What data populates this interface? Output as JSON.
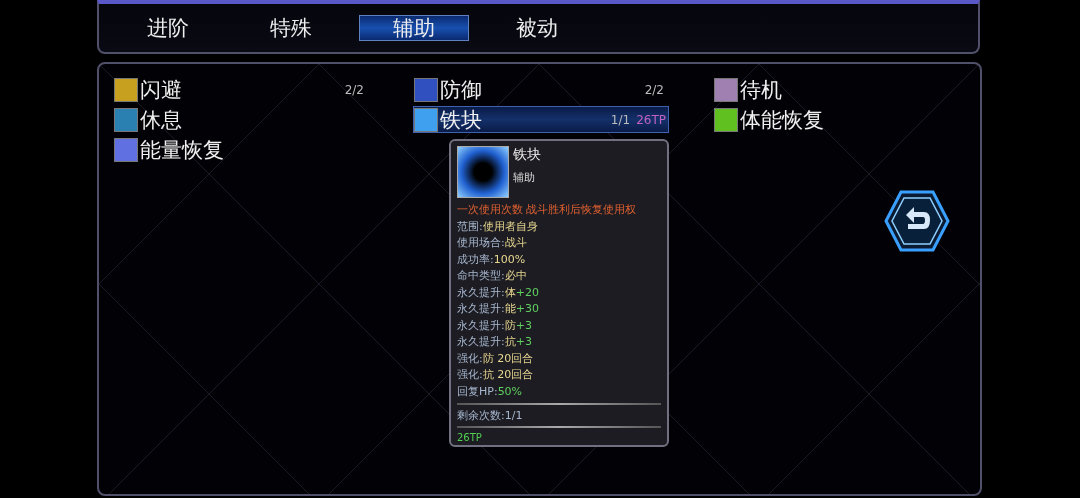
{
  "tabs": [
    {
      "label": "进阶",
      "selected": false
    },
    {
      "label": "特殊",
      "selected": false
    },
    {
      "label": "辅助",
      "selected": true
    },
    {
      "label": "被动",
      "selected": false
    }
  ],
  "skills": [
    {
      "name": "闪避",
      "count": "2/2",
      "color": "#c8a020",
      "selected": false
    },
    {
      "name": "防御",
      "count": "2/2",
      "color": "#3050c0",
      "selected": false
    },
    {
      "name": "待机",
      "color": "#a080b0",
      "selected": false
    },
    {
      "name": "休息",
      "color": "#2a80b0",
      "selected": false
    },
    {
      "name": "铁块",
      "count": "1/1",
      "cost": "26TP",
      "color": "#40a0f0",
      "selected": true
    },
    {
      "name": "体能恢复",
      "color": "#60c020",
      "selected": false
    },
    {
      "name": "能量恢复",
      "color": "#6070e0",
      "selected": false
    }
  ],
  "tooltip": {
    "name": "铁块",
    "category": "辅助",
    "lines": [
      {
        "kind": "note",
        "text": "一次使用次数 战斗胜利后恢复使用权"
      },
      {
        "kind": "stat",
        "label": "范围:",
        "value": "使用者自身"
      },
      {
        "kind": "stat",
        "label": "使用场合:",
        "value": "战斗"
      },
      {
        "kind": "stat",
        "label": "成功率:",
        "value": "100%"
      },
      {
        "kind": "stat",
        "label": "命中类型:",
        "value": "必中"
      },
      {
        "kind": "stat",
        "label": "永久提升:",
        "value": "体",
        "bonus": "+20"
      },
      {
        "kind": "stat",
        "label": "永久提升:",
        "value": "能",
        "bonus": "+30"
      },
      {
        "kind": "stat",
        "label": "永久提升:",
        "value": "防",
        "bonus": "+3"
      },
      {
        "kind": "stat",
        "label": "永久提升:",
        "value": "抗",
        "bonus": "+3"
      },
      {
        "kind": "stat",
        "label": "强化:",
        "value": "防 20回合"
      },
      {
        "kind": "stat",
        "label": "强化:",
        "value": "抗 20回合"
      },
      {
        "kind": "stat",
        "label": "回复HP:",
        "bonus": "50%"
      }
    ],
    "remaining": "剩余次数:1/1",
    "cost": "26TP"
  }
}
